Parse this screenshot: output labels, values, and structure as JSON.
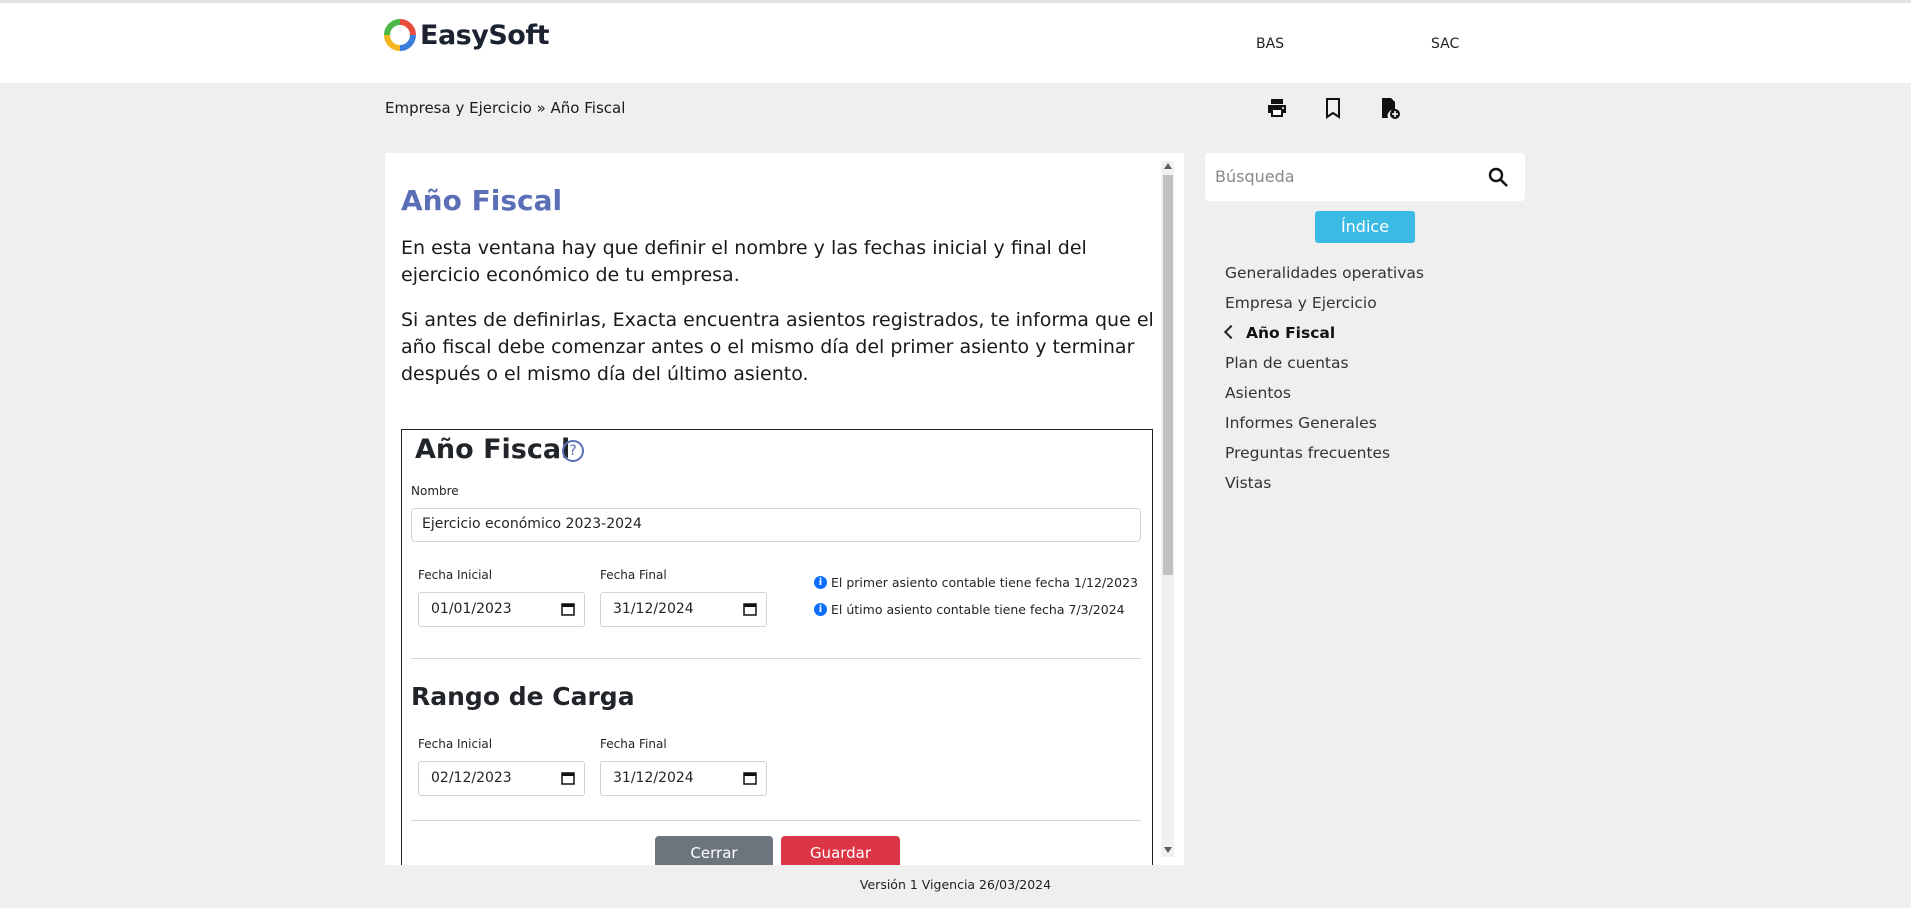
{
  "header": {
    "brand": "EasySoft",
    "links": [
      "BAS",
      "SAC"
    ]
  },
  "breadcrumb": "Empresa y Ejercicio » Año Fiscal",
  "toolbar_icons": [
    "print-icon",
    "bookmark-icon",
    "document-add-icon"
  ],
  "article": {
    "title": "Año Fiscal",
    "paragraphs": [
      "En esta ventana hay que definir el nombre y las fechas inicial y final del ejercicio económico de tu empresa.",
      "Si antes de definirlas, Exacta encuentra asientos registrados, te informa que el año fiscal debe comenzar antes o el mismo día del primer asiento y terminar después o el mismo día del último asiento."
    ]
  },
  "form": {
    "title": "Año Fiscal",
    "help_glyph": "?",
    "name_label": "Nombre",
    "name_value": "Ejercicio económico 2023-2024",
    "fecha_inicial_label": "Fecha Inicial",
    "fecha_final_label": "Fecha Final",
    "fecha_inicial": "01/01/2023",
    "fecha_final": "31/12/2024",
    "info_1": "El primer asiento contable tiene fecha 1/12/2023",
    "info_2": "El útimo asiento contable tiene fecha 7/3/2024",
    "info_glyph": "i",
    "rango_title": "Rango de Carga",
    "rango_inicial_label": "Fecha Inicial",
    "rango_final_label": "Fecha Final",
    "rango_inicial": "02/12/2023",
    "rango_final": "31/12/2024",
    "close_button": "Cerrar",
    "save_button": "Guardar"
  },
  "search": {
    "placeholder": "Búsqueda"
  },
  "index_button": "Índice",
  "nav": [
    "Generalidades operativas",
    "Empresa y Ejercicio",
    "Año Fiscal",
    "Plan de cuentas",
    "Asientos",
    "Informes Generales",
    "Preguntas frecuentes",
    "Vistas"
  ],
  "footer": "Versión 1 Vigencia 26/03/2024",
  "colors": {
    "title": "#5b6fb6",
    "index_button": "#3bbbe3",
    "save_button": "#dc3545",
    "close_button": "#6c757d"
  }
}
